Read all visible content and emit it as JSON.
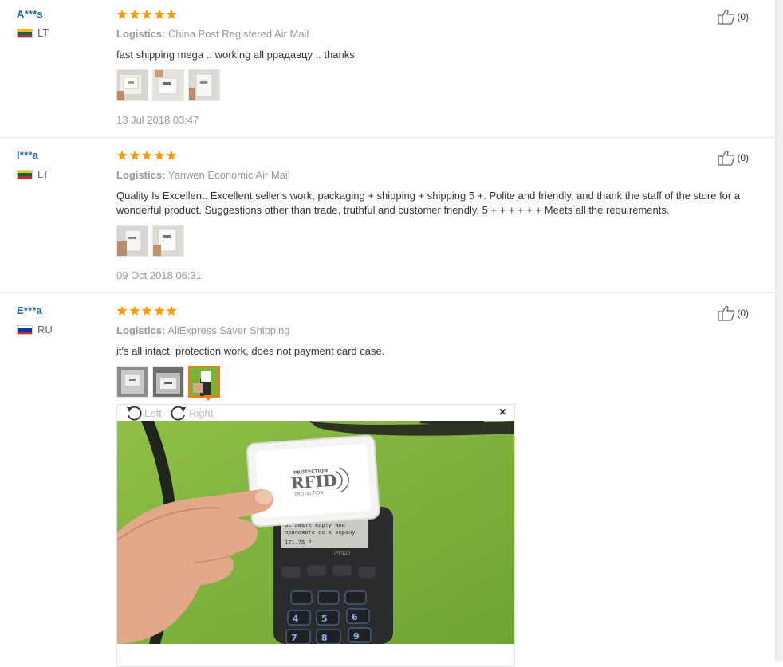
{
  "reviews": [
    {
      "user": "A***s",
      "country": "LT",
      "flag_colors": [
        "#fdb913",
        "#006a44",
        "#c1272d"
      ],
      "rating": 5,
      "logistics_label": "Logistics:",
      "logistics_value": "China Post Registered Air Mail",
      "text": "fast shipping mega .. working all ррадавцу .. thanks",
      "photos": 3,
      "date": "13 Jul 2018 03:47",
      "helpful": "(0)"
    },
    {
      "user": "I***a",
      "country": "LT",
      "flag_colors": [
        "#fdb913",
        "#006a44",
        "#c1272d"
      ],
      "rating": 5,
      "logistics_label": "Logistics:",
      "logistics_value": "Yanwen Economic Air Mail",
      "text": "Quality Is Excellent. Excellent seller's work, packaging + shipping + shipping 5 +. Polite and friendly, and thank the staff of the store for a wonderful product. Suggestions other than trade, truthful and customer friendly. 5 + + + + + + Meets all the requirements.",
      "photos": 2,
      "date": "09 Oct 2018 06:31",
      "helpful": "(0)"
    },
    {
      "user": "E***a",
      "country": "RU",
      "flag_colors": [
        "#ffffff",
        "#0039a6",
        "#d52b1e"
      ],
      "rating": 5,
      "logistics_label": "Logistics:",
      "logistics_value": "AliExpress Saver Shipping",
      "text": "it's all intact. protection work, does not payment card case.",
      "photos": 3,
      "selected_photo": 3,
      "helpful": "(0)"
    }
  ],
  "viewer": {
    "rotate_left": "Left",
    "rotate_right": "Right",
    "close": "×",
    "card_brand": "RFID",
    "card_top": "PROTECTION",
    "card_bottom": "PROTECTION",
    "screen_line1": "Вставьте карту или",
    "screen_line2": "приложите ее к экрану",
    "screen_amount": "171.75 Р",
    "terminal_model": "iPP320"
  },
  "colors": {
    "star": "#ff9a00",
    "accent": "#ff7a00",
    "username": "#2266aa",
    "muted": "#999999"
  },
  "icons": [
    "star-icon",
    "thumbs-up-icon",
    "rotate-left-icon",
    "rotate-right-icon",
    "close-icon"
  ]
}
